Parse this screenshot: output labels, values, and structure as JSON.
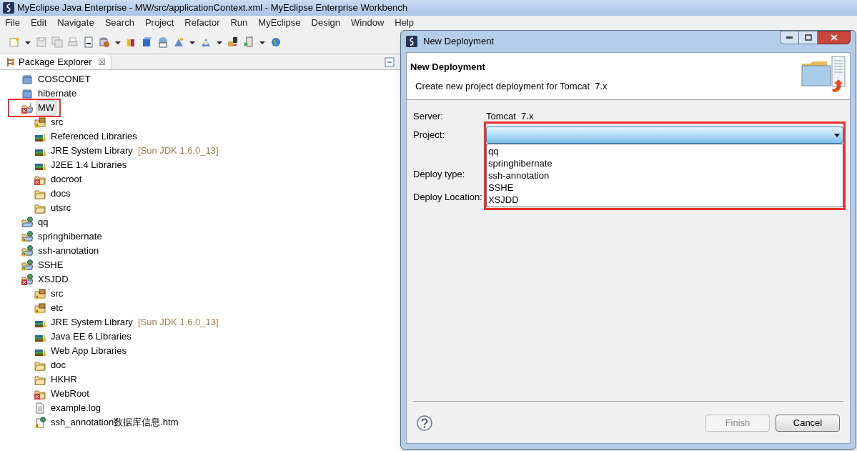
{
  "window": {
    "title": "MyEclipse Java Enterprise - MW/src/applicationContext.xml - MyEclipse Enterprise Workbench"
  },
  "menu": [
    "File",
    "Edit",
    "Navigate",
    "Search",
    "Project",
    "Refactor",
    "Run",
    "MyEclipse",
    "Design",
    "Window",
    "Help"
  ],
  "view": {
    "title": "Package Explorer",
    "close": "☒"
  },
  "tree": [
    {
      "label": "COSCONET",
      "kind": "closed-project",
      "error": false,
      "warning": false,
      "selected": false
    },
    {
      "label": "hibernate",
      "kind": "closed-project",
      "error": false,
      "warning": false,
      "selected": false
    },
    {
      "label": "MW",
      "kind": "project",
      "error": true,
      "warning": false,
      "selected": true,
      "children": [
        {
          "label": "src",
          "kind": "package-root",
          "error": false,
          "warning": true,
          "selected": false
        },
        {
          "label": "Referenced Libraries",
          "kind": "library",
          "error": false,
          "warning": false,
          "selected": false
        },
        {
          "label": "JRE System Library",
          "decoration": "[Sun JDK 1.6.0_13]",
          "kind": "library",
          "error": false,
          "warning": false,
          "selected": false
        },
        {
          "label": "J2EE 1.4 Libraries",
          "kind": "library",
          "error": false,
          "warning": false,
          "selected": false
        },
        {
          "label": "docroot",
          "kind": "folder",
          "error": true,
          "warning": false,
          "selected": false
        },
        {
          "label": "docs",
          "kind": "folder",
          "error": false,
          "warning": false,
          "selected": false
        },
        {
          "label": "utsrc",
          "kind": "folder",
          "error": false,
          "warning": false,
          "selected": false
        }
      ]
    },
    {
      "label": "qq",
      "kind": "web-project",
      "error": false,
      "warning": false,
      "selected": false
    },
    {
      "label": "springhibernate",
      "kind": "web-project",
      "error": false,
      "warning": true,
      "selected": false
    },
    {
      "label": "ssh-annotation",
      "kind": "web-project",
      "error": false,
      "warning": true,
      "selected": false
    },
    {
      "label": "SSHE",
      "kind": "web-project",
      "error": false,
      "warning": true,
      "selected": false
    },
    {
      "label": "XSJDD",
      "kind": "web-project",
      "error": true,
      "warning": false,
      "selected": false,
      "children": [
        {
          "label": "src",
          "kind": "package-root",
          "error": false,
          "warning": true,
          "selected": false
        },
        {
          "label": "etc",
          "kind": "package-root",
          "error": false,
          "warning": true,
          "selected": false
        },
        {
          "label": "JRE System Library",
          "decoration": "[Sun JDK 1.6.0_13]",
          "kind": "library",
          "error": false,
          "warning": false,
          "selected": false
        },
        {
          "label": "Java EE 6 Libraries",
          "kind": "library",
          "error": false,
          "warning": false,
          "selected": false
        },
        {
          "label": "Web App Libraries",
          "kind": "library",
          "error": false,
          "warning": false,
          "selected": false
        },
        {
          "label": "doc",
          "kind": "folder",
          "error": false,
          "warning": false,
          "selected": false
        },
        {
          "label": "HKHR",
          "kind": "folder",
          "error": false,
          "warning": false,
          "selected": false
        },
        {
          "label": "WebRoot",
          "kind": "folder",
          "error": true,
          "warning": false,
          "selected": false
        },
        {
          "label": "example.log",
          "kind": "file",
          "error": false,
          "warning": false,
          "selected": false
        },
        {
          "label": "ssh_annotation数据库信息.htm",
          "kind": "web-file",
          "error": false,
          "warning": true,
          "selected": false
        }
      ]
    }
  ],
  "dialog": {
    "title": "New Deployment",
    "heading": "New Deployment",
    "description": "Create new project deployment for Tomcat  7.x",
    "fields": [
      {
        "label": "Server:",
        "kind": "text",
        "value": "Tomcat  7.x"
      },
      {
        "label": "Project:",
        "kind": "combo",
        "expanded": true,
        "options": [
          "qq",
          "springhibernate",
          "ssh-annotation",
          "SSHE",
          "XSJDD"
        ]
      },
      {
        "label": "Deploy type:",
        "kind": "label"
      },
      {
        "label": "Deploy Location:",
        "kind": "label"
      }
    ],
    "buttons": [
      {
        "label": "Finish",
        "disabled": true
      },
      {
        "label": "Cancel",
        "disabled": false
      }
    ]
  }
}
